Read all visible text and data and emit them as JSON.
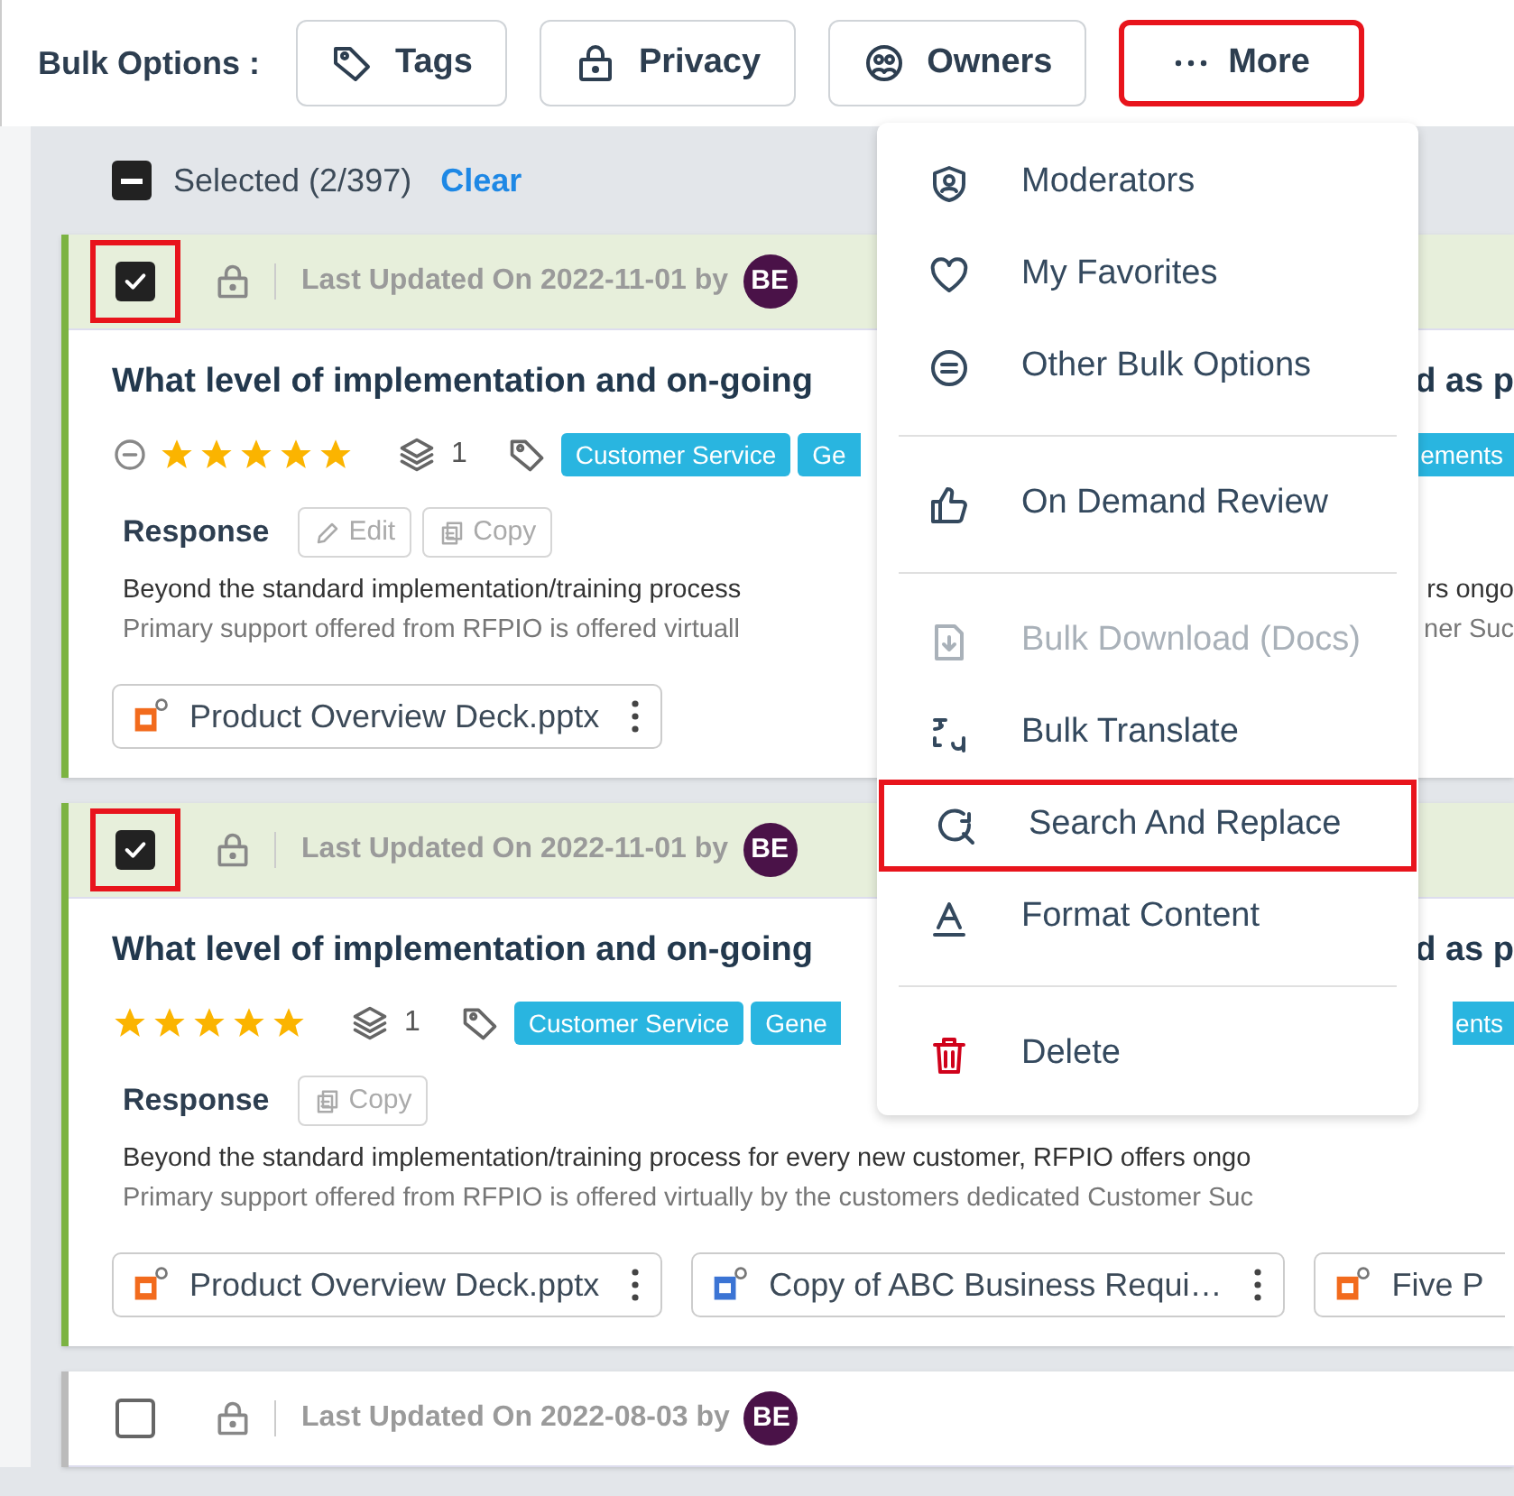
{
  "toolbar": {
    "label": "Bulk Options :",
    "buttons": [
      {
        "label": "Tags",
        "highlighted": false
      },
      {
        "label": "Privacy",
        "highlighted": false
      },
      {
        "label": "Owners",
        "highlighted": false
      },
      {
        "label": "More",
        "highlighted": true
      }
    ]
  },
  "selection": {
    "indeterminate": true,
    "label": "Selected (2/397)",
    "action": "Clear"
  },
  "cards": [
    {
      "checked": true,
      "highlighted": true,
      "updated": "Last Updated On 2022-11-01 by",
      "avatar": "BE",
      "question": "What level of implementation and on-going",
      "question_right": "d as p",
      "rating_clear": true,
      "stars": 5,
      "versions": "1",
      "tags": [
        "Customer Service",
        "Ge"
      ],
      "tags_right": [
        "ements"
      ],
      "response_label": "Response",
      "actions": [
        "Edit",
        "Copy"
      ],
      "body": [
        {
          "left": "Beyond the standard implementation/training process",
          "right": "rs ongo"
        },
        {
          "left": "Primary support offered from RFPIO is offered virtuall",
          "right": "ner Suc"
        }
      ],
      "attachments": [
        {
          "name": "Product Overview Deck.pptx",
          "kind": "pptx",
          "menu": true
        }
      ]
    },
    {
      "checked": true,
      "highlighted": true,
      "updated": "Last Updated On 2022-11-01 by",
      "avatar": "BE",
      "question": "What level of implementation and on-going",
      "question_right": "d as p",
      "rating_clear": false,
      "stars": 5,
      "versions": "1",
      "tags": [
        "Customer Service",
        "Gene"
      ],
      "tags_right": [
        "ents"
      ],
      "response_label": "Response",
      "actions": [
        "Copy"
      ],
      "body": [
        {
          "left": "Beyond the standard implementation/training process for every new customer, RFPIO offers ongo"
        },
        {
          "left": "Primary support offered from RFPIO is offered virtually by the customers dedicated Customer Suc"
        }
      ],
      "attachments": [
        {
          "name": "Product Overview Deck.pptx",
          "kind": "pptx",
          "menu": true
        },
        {
          "name": "Copy of ABC Business Requi…",
          "kind": "docx",
          "menu": true
        },
        {
          "name": "Five P",
          "kind": "pptx",
          "menu": false
        }
      ]
    },
    {
      "checked": false,
      "highlighted": false,
      "updated": "Last Updated On 2022-08-03 by",
      "avatar": "BE"
    }
  ],
  "menu": {
    "groups": [
      [
        {
          "label": "Moderators",
          "disabled": false,
          "highlighted": false
        },
        {
          "label": "My Favorites",
          "disabled": false,
          "highlighted": false
        },
        {
          "label": "Other Bulk Options",
          "disabled": false,
          "highlighted": false
        }
      ],
      [
        {
          "label": "On Demand Review",
          "disabled": false,
          "highlighted": false
        }
      ],
      [
        {
          "label": "Bulk Download (Docs)",
          "disabled": true,
          "highlighted": false
        },
        {
          "label": "Bulk Translate",
          "disabled": false,
          "highlighted": false
        },
        {
          "label": "Search And Replace",
          "disabled": false,
          "highlighted": true
        },
        {
          "label": "Format Content",
          "disabled": false,
          "highlighted": false
        }
      ],
      [
        {
          "label": "Delete",
          "disabled": false,
          "highlighted": false
        }
      ]
    ]
  }
}
